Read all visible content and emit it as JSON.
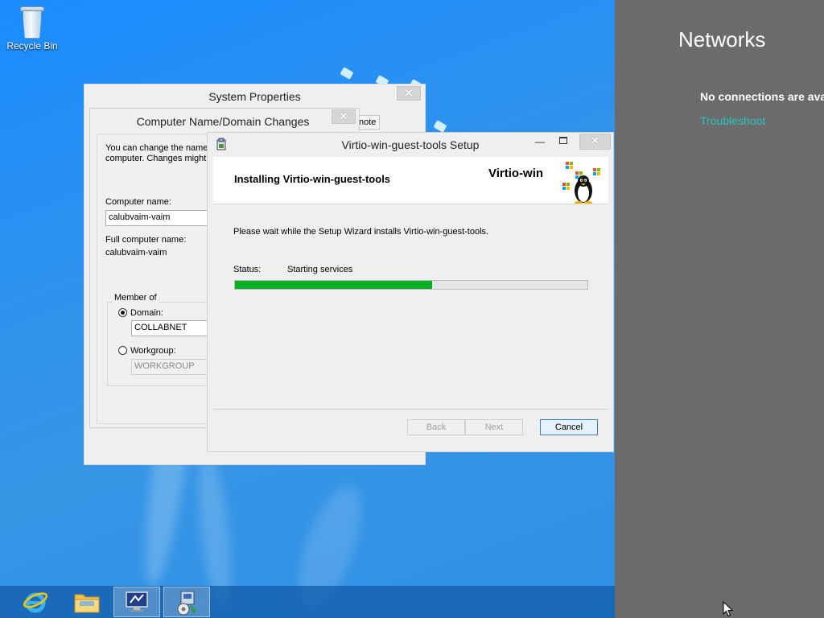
{
  "desktop": {
    "recycle_bin_label": "Recycle Bin"
  },
  "networks_panel": {
    "title": "Networks",
    "no_connections": "No connections are ava",
    "troubleshoot": "Troubleshoot"
  },
  "system_properties": {
    "title": "System Properties",
    "tab_partial": "note",
    "close_glyph": "✕"
  },
  "computer_name_dialog": {
    "title": "Computer Name/Domain Changes",
    "description": "You can change the name\ncomputer. Changes might a",
    "computer_name_label": "Computer name:",
    "computer_name_value": "calubvaim-vaim",
    "full_name_label": "Full computer name:",
    "full_name_value": "calubvaim-vaim",
    "member_of_label": "Member of",
    "domain_label": "Domain:",
    "domain_value": "COLLABNET",
    "workgroup_label": "Workgroup:",
    "workgroup_value": "WORKGROUP",
    "selected": "domain"
  },
  "setup_wizard": {
    "title": "Virtio-win-guest-tools Setup",
    "heading": "Installing Virtio-win-guest-tools",
    "brand": "Virtio-win",
    "wait_text": "Please wait while the Setup Wizard installs Virtio-win-guest-tools.",
    "status_label": "Status:",
    "status_value": "Starting services",
    "progress": 0.56,
    "back_label": "Back",
    "next_label": "Next",
    "cancel_label": "Cancel",
    "minimize_glyph": "—",
    "close_glyph": "✕"
  },
  "taskbar": {
    "items": [
      {
        "icon": "internet-explorer-icon",
        "active": false
      },
      {
        "icon": "file-explorer-icon",
        "active": false
      },
      {
        "icon": "system-properties-icon",
        "active": true
      },
      {
        "icon": "setup-installer-icon",
        "active": true
      }
    ]
  },
  "colors": {
    "desktop_blue": "#2d92ee",
    "charm_panel": "#6b6b6b",
    "link_teal": "#27c4c2",
    "progress_green": "#06b025"
  }
}
